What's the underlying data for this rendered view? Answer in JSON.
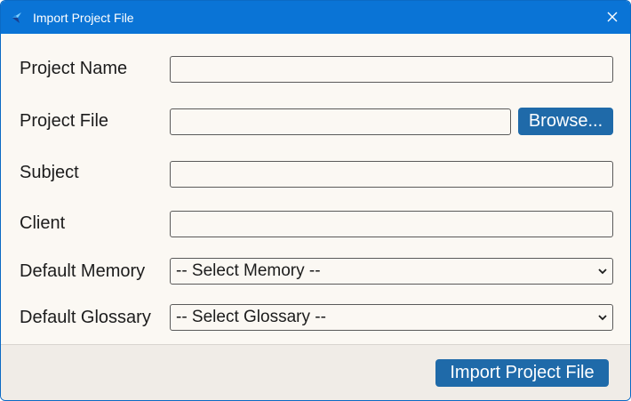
{
  "window": {
    "title": "Import Project File"
  },
  "form": {
    "project_name": {
      "label": "Project Name",
      "value": ""
    },
    "project_file": {
      "label": "Project File",
      "value": "",
      "browse_label": "Browse..."
    },
    "subject": {
      "label": "Subject",
      "value": ""
    },
    "client": {
      "label": "Client",
      "value": ""
    },
    "default_memory": {
      "label": "Default Memory",
      "selected": "-- Select Memory --"
    },
    "default_glossary": {
      "label": "Default Glossary",
      "selected": "-- Select Glossary --"
    }
  },
  "footer": {
    "submit_label": "Import Project File"
  },
  "icons": {
    "app": "app-logo-icon",
    "close": "close-icon",
    "dropdown": "chevron-down-icon"
  },
  "colors": {
    "titlebar": "#0a74d6",
    "button": "#1f6aa9",
    "background": "#fbf8f3",
    "footer": "#f0ece7"
  }
}
